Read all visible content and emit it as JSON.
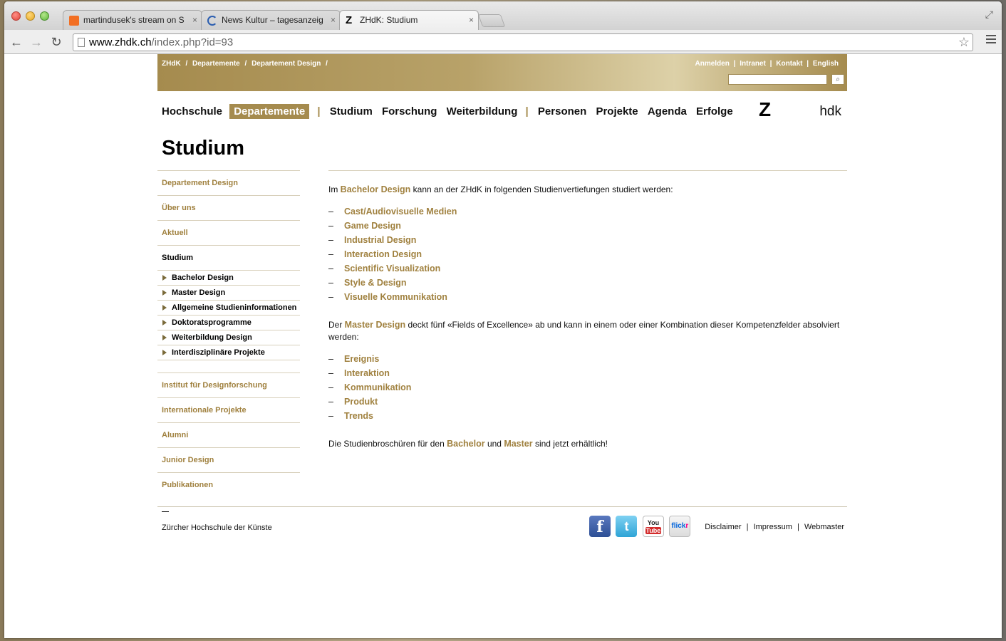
{
  "browser": {
    "tabs": [
      {
        "title": "martindusek's stream on S",
        "icon_color": "#f26f23"
      },
      {
        "title": "News Kultur – tagesanzeig",
        "icon_color": "#2a5db0"
      },
      {
        "title": "ZHdK: Studium",
        "icon_color": "#000000"
      }
    ],
    "close_glyph": "×",
    "url_host": "www.zhdk.ch",
    "url_path": "/index.php?id=93"
  },
  "site": {
    "accent_color": "#a58b4e",
    "breadcrumb": [
      "ZHdK",
      "/",
      "Departemente",
      "/",
      "Departement Design",
      "/"
    ],
    "utility_links": [
      "Anmelden",
      "|",
      "Intranet",
      "|",
      "Kontakt",
      "|",
      "English"
    ],
    "main_nav": {
      "left": [
        "Hochschule",
        "Departemente"
      ],
      "sep": "|",
      "middle": [
        "Studium",
        "Forschung",
        "Weiterbildung"
      ],
      "right": [
        "Personen",
        "Projekte",
        "Agenda",
        "Erfolge"
      ]
    },
    "logo_z": "Z",
    "logo_hdk": "hdk",
    "page_title": "Studium"
  },
  "sidebar": {
    "top_items": [
      "Departement Design",
      "Über uns",
      "Aktuell"
    ],
    "current": "Studium",
    "sub_items": [
      "Bachelor Design",
      "Master Design",
      "Allgemeine Studieninformationen",
      "Doktoratsprogramme",
      "Weiterbildung Design",
      "Interdisziplinäre Projekte"
    ],
    "bottom_items": [
      "Institut für Designforschung",
      "Internationale Projekte",
      "Alumni",
      "Junior Design",
      "Publikationen"
    ]
  },
  "content": {
    "intro_pre": "Im ",
    "intro_link": "Bachelor Design",
    "intro_post": " kann an der ZHdK in folgenden Studienvertiefungen studiert werden:",
    "bachelor_list": [
      "Cast/Audiovisuelle Medien",
      "Game Design",
      "Industrial Design",
      "Interaction Design",
      "Scientific Visualization",
      "Style & Design",
      "Visuelle Kommunikation"
    ],
    "master_pre": "Der ",
    "master_link": "Master Design",
    "master_post": " deckt fünf «Fields of Excellence» ab und kann in einem oder einer Kombination dieser Kompetenzfelder absolviert werden:",
    "master_list": [
      "Ereignis",
      "Interaktion",
      "Kommunikation",
      "Produkt",
      "Trends"
    ],
    "dash": "–",
    "outro_pre": "Die Studienbroschüren für den ",
    "outro_link1": "Bachelor",
    "outro_mid": " und ",
    "outro_link2": "Master",
    "outro_post": " sind jetzt erhältlich!"
  },
  "footer": {
    "institution": "Zürcher Hochschule der Künste",
    "social": [
      {
        "name": "facebook",
        "glyph": "f"
      },
      {
        "name": "twitter",
        "glyph": "t"
      },
      {
        "name": "youtube",
        "glyph_top": "You",
        "glyph_bottom": "Tube"
      },
      {
        "name": "flickr",
        "glyph_a": "flick",
        "glyph_b": "r"
      }
    ],
    "legal": [
      "Disclaimer",
      "|",
      "Impressum",
      "|",
      "Webmaster"
    ]
  }
}
